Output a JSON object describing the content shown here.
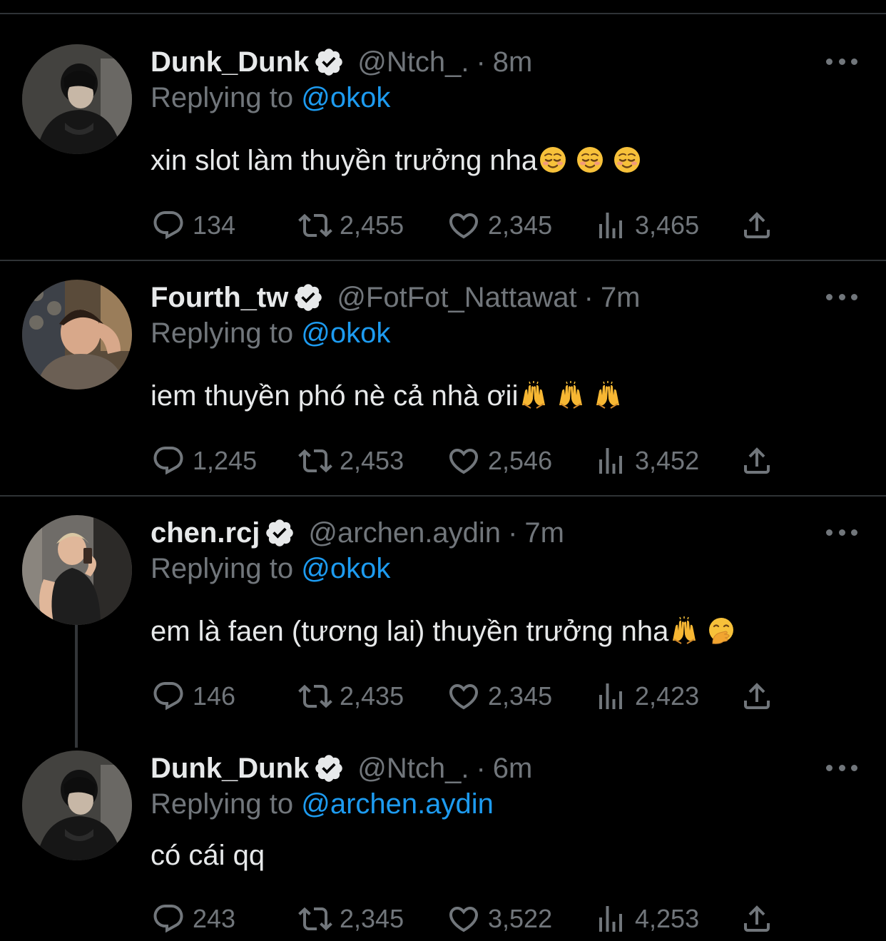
{
  "replying_prefix": "Replying to",
  "tweets": [
    {
      "name": "Dunk_Dunk",
      "handle": "@Ntch_.",
      "time": "8m",
      "reply_to": "@okok",
      "text": " xin slot làm thuyền trưởng nha",
      "emojis": [
        "relieved-emoji",
        "relieved-emoji",
        "relieved-emoji"
      ],
      "replies": "134",
      "retweets": "2,455",
      "likes": "2,345",
      "views": "3,465"
    },
    {
      "name": "Fourth_tw",
      "handle": "@FotFot_Nattawat",
      "time": "7m",
      "reply_to": "@okok",
      "text": "iem thuyền phó nè cả nhà ơii",
      "emojis": [
        "raising-hands-emoji",
        "raising-hands-emoji",
        "raising-hands-emoji"
      ],
      "replies": "1,245",
      "retweets": "2,453",
      "likes": "2,546",
      "views": "3,452"
    },
    {
      "name": "chen.rcj",
      "handle": "@archen.aydin",
      "time": "7m",
      "reply_to": "@okok",
      "text": "em là faen (tương lai) thuyền trưởng nha",
      "emojis": [
        "raising-hands-emoji",
        "face-with-hand-over-mouth-emoji"
      ],
      "replies": "146",
      "retweets": "2,435",
      "likes": "2,345",
      "views": "2,423"
    },
    {
      "name": "Dunk_Dunk",
      "handle": "@Ntch_.",
      "time": "6m",
      "reply_to": "@archen.aydin",
      "text": "có cái qq",
      "emojis": [],
      "replies": "243",
      "retweets": "2,345",
      "likes": "3,522",
      "views": "4,253"
    }
  ],
  "colors": {
    "background": "#000000",
    "text": "#e7e9ea",
    "secondary": "#71767b",
    "link": "#1d9bf0",
    "divider": "#2f3336"
  }
}
